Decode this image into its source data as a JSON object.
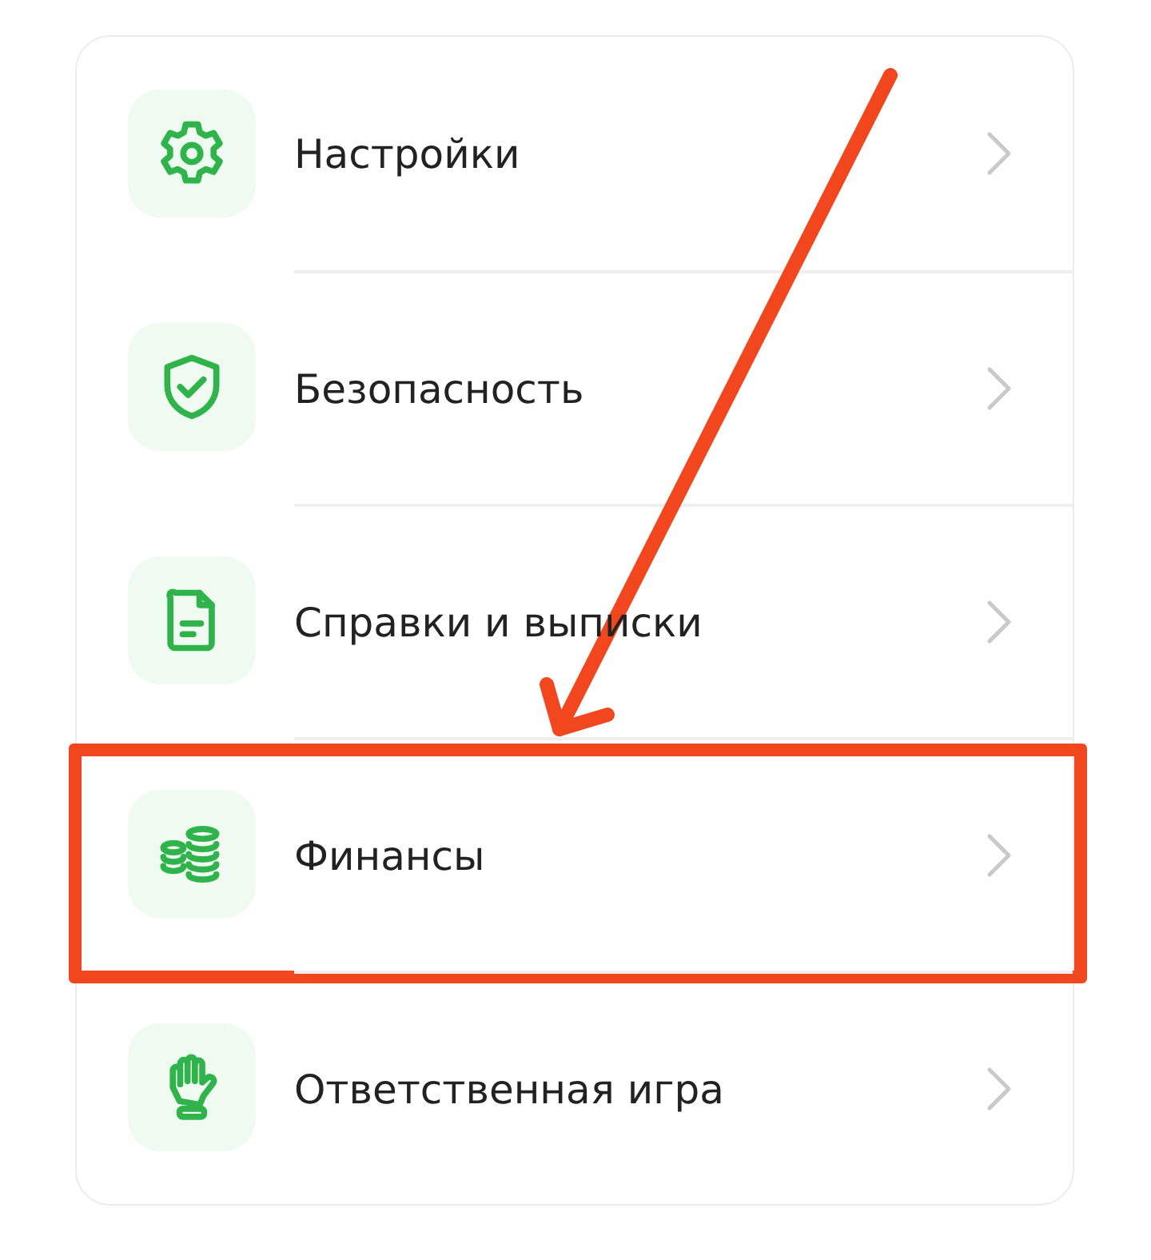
{
  "menu": {
    "items": [
      {
        "kind": "gear",
        "label": "Настройки",
        "highlighted": false
      },
      {
        "kind": "shield",
        "label": "Безопасность",
        "highlighted": false
      },
      {
        "kind": "document",
        "label": "Справки и выписки",
        "highlighted": false
      },
      {
        "kind": "coins",
        "label": "Финансы",
        "highlighted": true
      },
      {
        "kind": "hand",
        "label": "Ответственная игра",
        "highlighted": false
      }
    ]
  }
}
